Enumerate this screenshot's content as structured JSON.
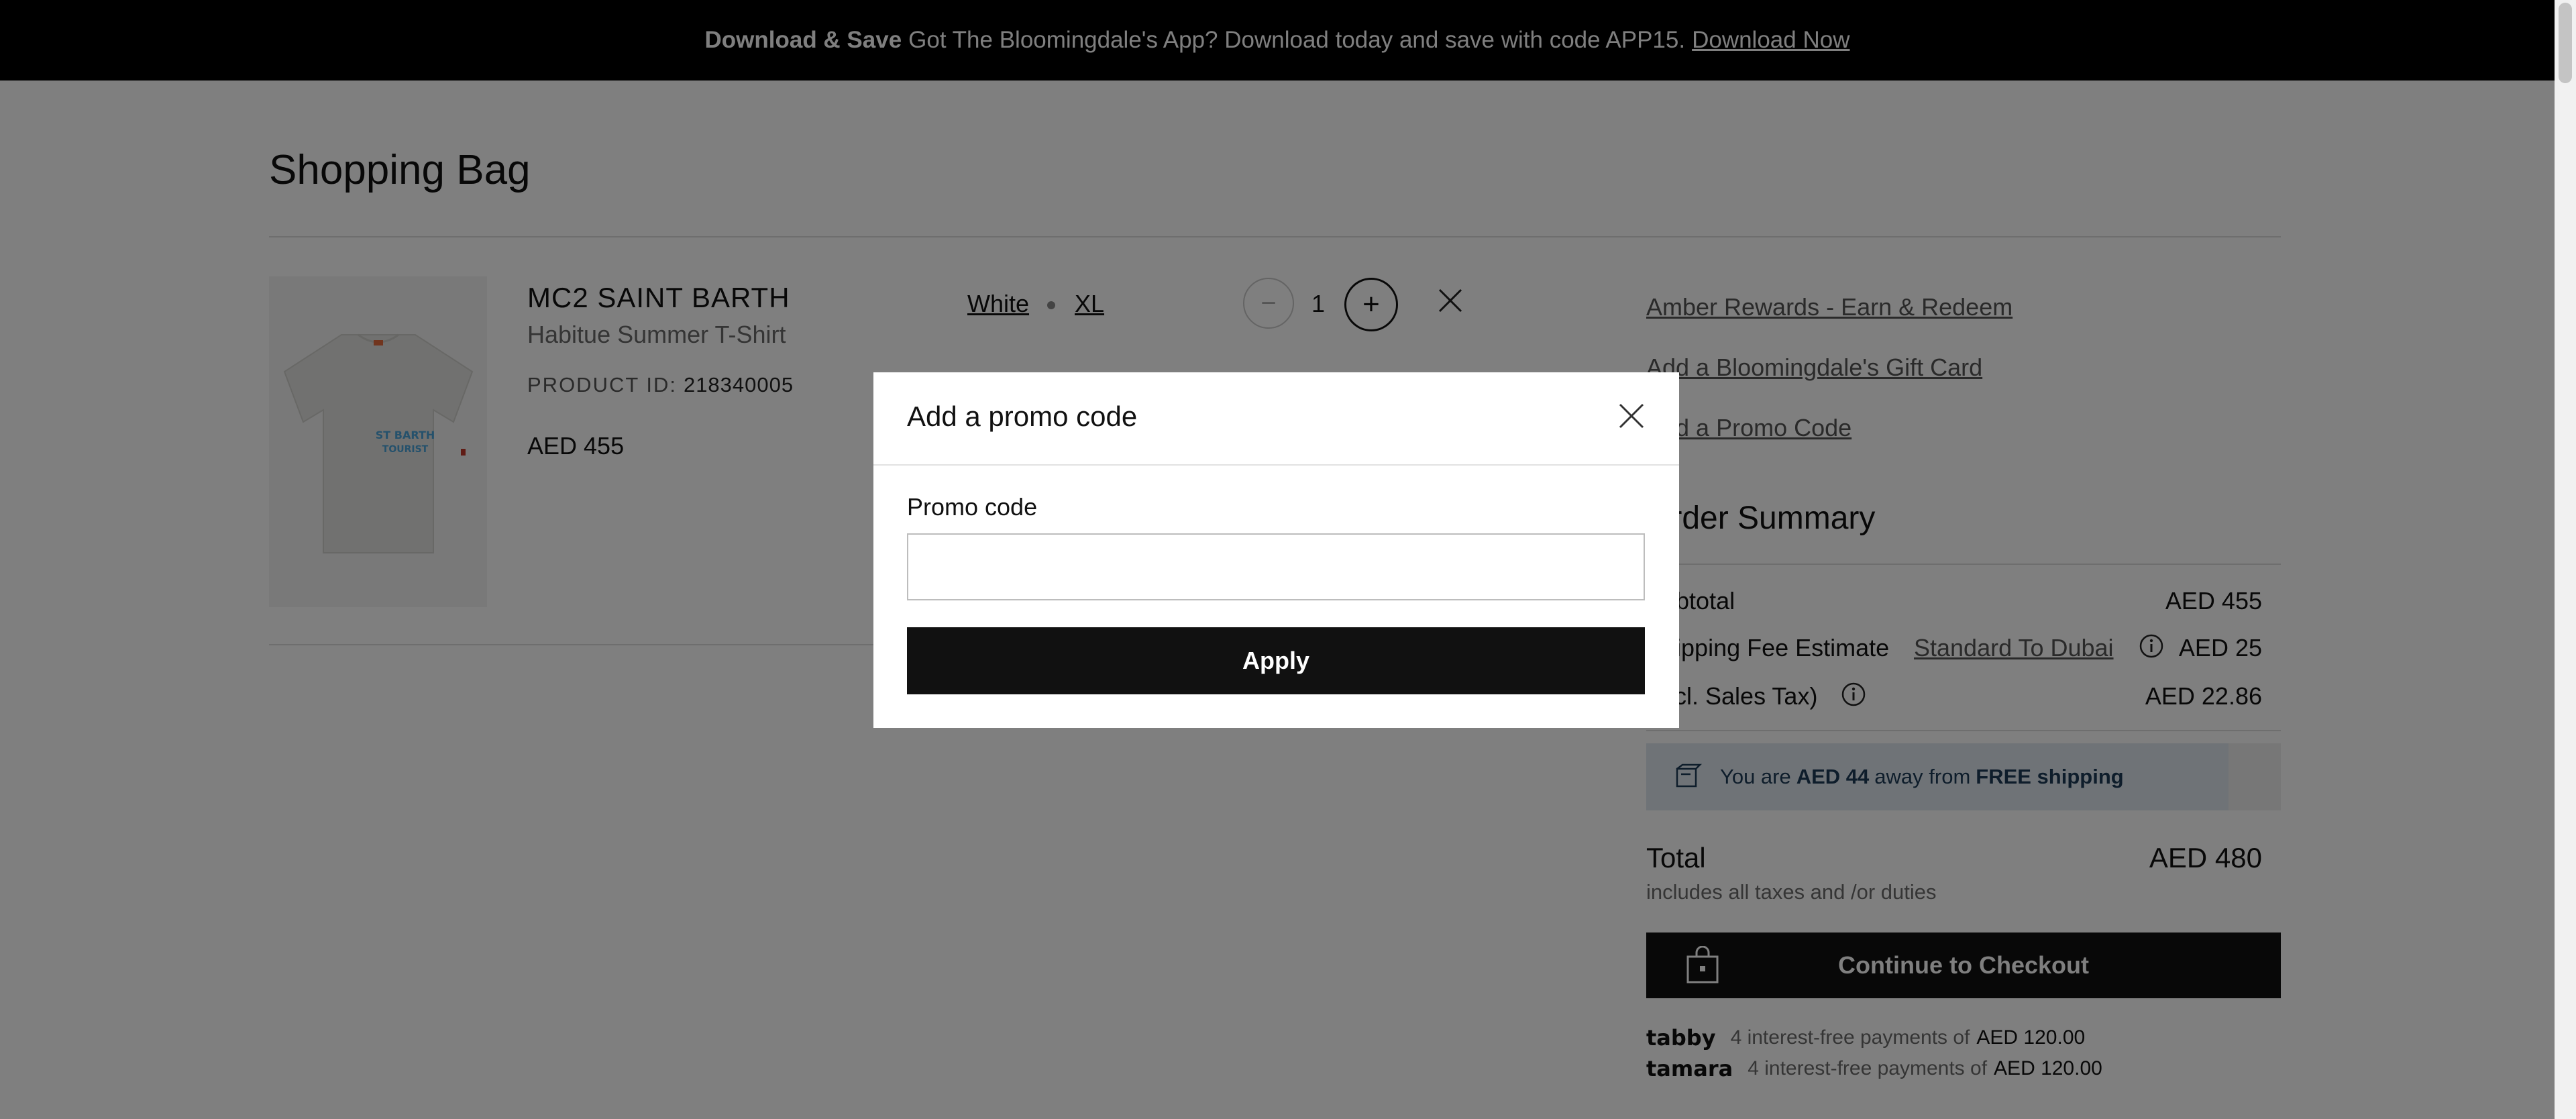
{
  "banner": {
    "bold": "Download & Save",
    "text": "Got The Bloomingdale's App? Download today and save with code APP15.",
    "link": "Download Now"
  },
  "bag": {
    "title": "Shopping Bag"
  },
  "item": {
    "brand": "MC2 SAINT BARTH",
    "name": "Habitue Summer T-Shirt",
    "product_id_label": "PRODUCT ID:",
    "product_id": "218340005",
    "price": "AED 455",
    "color": "White",
    "size": "XL",
    "quantity": "1",
    "minus_symbol": "−",
    "plus_symbol": "+"
  },
  "sidebar": {
    "rewards_link": "Amber Rewards - Earn & Redeem",
    "gift_card_link": "Add a Bloomingdale's Gift Card",
    "promo_link": "Add a Promo Code"
  },
  "summary": {
    "title": "Order Summary",
    "subtotal_label": "Subtotal",
    "subtotal_value": "AED 455",
    "shipping_label": "Shipping Fee Estimate",
    "shipping_link": "Standard To Dubai",
    "shipping_value": "AED 25",
    "tax_label": "(Incl. Sales Tax)",
    "tax_value": "AED 22.86",
    "free_shipping_pre": "You are",
    "free_shipping_amount": "AED 44",
    "free_shipping_mid": "away from",
    "free_shipping_bold": "FREE shipping",
    "total_label": "Total",
    "total_value": "AED 480",
    "total_note": "includes all taxes and /or duties",
    "checkout_label": "Continue to Checkout"
  },
  "bnpl": [
    {
      "logo": "tabby",
      "text": "4 interest-free payments of",
      "amount": "AED 120.00"
    },
    {
      "logo": "tamara",
      "text": "4 interest-free payments of",
      "amount": "AED 120.00"
    }
  ],
  "modal": {
    "title": "Add a promo code",
    "field_label": "Promo code",
    "input_value": "",
    "apply_label": "Apply"
  },
  "icons": {
    "close": "close-icon",
    "info": "info-icon",
    "truck": "shipping-icon",
    "bag": "shopping-bag-icon"
  }
}
